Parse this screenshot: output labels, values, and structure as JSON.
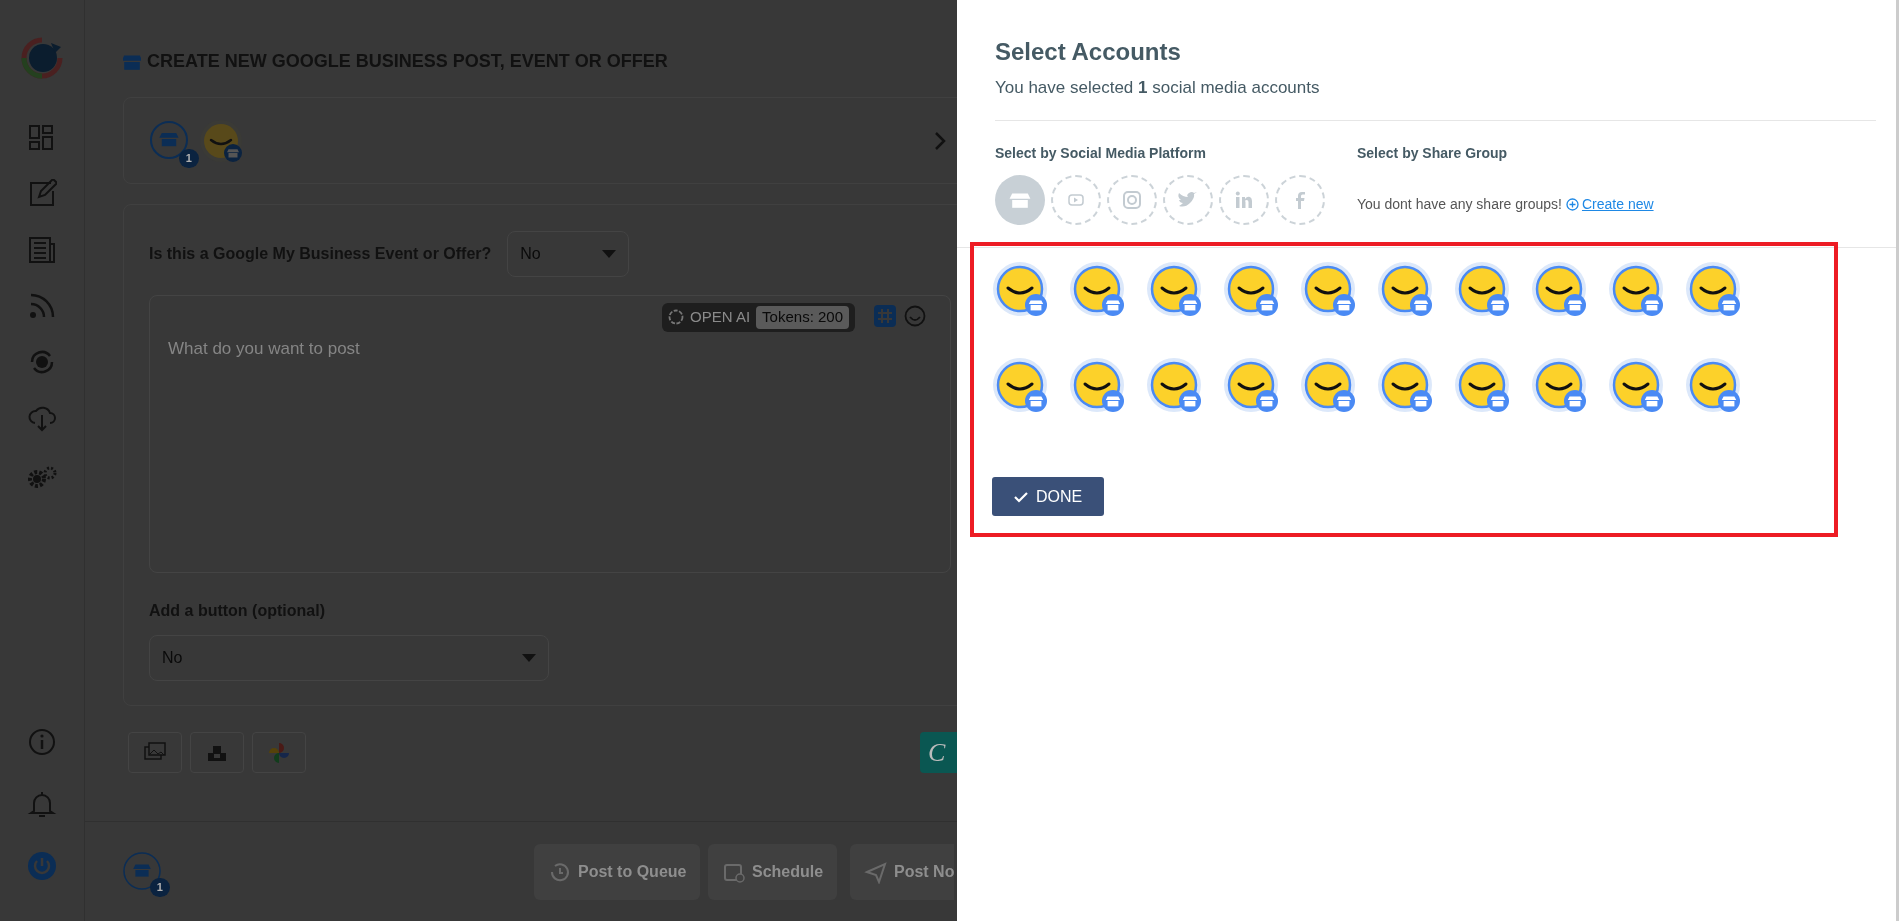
{
  "page": {
    "title": "CREATE NEW GOOGLE BUSINESS POST, EVENT OR OFFER",
    "account_badge": "1",
    "event_question": {
      "label": "Is this a Google My Business Event or Offer?",
      "value": "No"
    },
    "composer": {
      "placeholder": "What do you want to post",
      "ai_label": "OPEN AI",
      "tokens": "Tokens: 200"
    },
    "button_select": {
      "label": "Add a button (optional)",
      "value": "No"
    },
    "canva": "C",
    "footer": {
      "badge": "1",
      "actions": [
        {
          "kind": "queue",
          "label": "Post to Queue"
        },
        {
          "kind": "schedule",
          "label": "Schedule"
        },
        {
          "kind": "send",
          "label": "Post No"
        }
      ]
    }
  },
  "panel": {
    "title": "Select Accounts",
    "subtitle": "You have selected **1** social media accounts",
    "platform_heading": "Select by Social Media Platform",
    "platforms": [
      {
        "kind": "gmb",
        "selected": true
      },
      {
        "kind": "youtube",
        "selected": false
      },
      {
        "kind": "instagram",
        "selected": false
      },
      {
        "kind": "twitter",
        "selected": false
      },
      {
        "kind": "linkedin",
        "selected": false
      },
      {
        "kind": "facebook",
        "selected": false
      }
    ],
    "group_heading": "Select by Share Group",
    "group_note": "You dont have any share groups!",
    "create_link": "Create new",
    "highlighted": true,
    "accounts": [
      {
        "kind": "gmb"
      },
      {
        "kind": "gmb"
      },
      {
        "kind": "gmb"
      },
      {
        "kind": "gmb"
      },
      {
        "kind": "gmb"
      },
      {
        "kind": "gmb"
      },
      {
        "kind": "gmb"
      },
      {
        "kind": "gmb"
      },
      {
        "kind": "gmb"
      },
      {
        "kind": "gmb"
      },
      {
        "kind": "gmb"
      },
      {
        "kind": "gmb"
      },
      {
        "kind": "gmb"
      },
      {
        "kind": "gmb"
      },
      {
        "kind": "gmb"
      },
      {
        "kind": "gmb"
      },
      {
        "kind": "gmb"
      },
      {
        "kind": "gmb"
      },
      {
        "kind": "gmb"
      },
      {
        "kind": "gmb"
      }
    ],
    "done": "DONE"
  }
}
